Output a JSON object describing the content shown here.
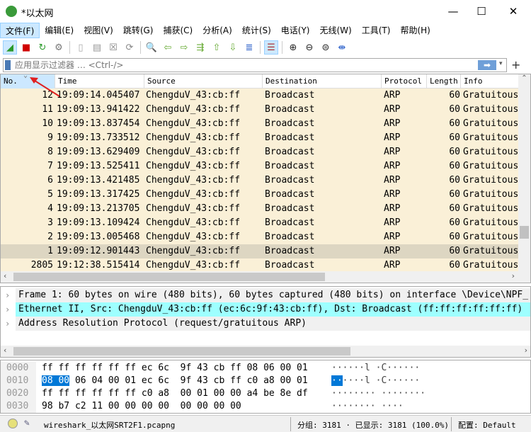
{
  "window": {
    "title": "*以太网",
    "minimize": "—",
    "maximize": "☐",
    "close": "✕"
  },
  "menu": [
    "文件(F)",
    "编辑(E)",
    "视图(V)",
    "跳转(G)",
    "捕获(C)",
    "分析(A)",
    "统计(S)",
    "电话(Y)",
    "无线(W)",
    "工具(T)",
    "帮助(H)"
  ],
  "toolbar": [
    {
      "icon": "shark-fin-start-icon",
      "glyph": "◢",
      "color": "#2a9a2a",
      "on": true
    },
    {
      "icon": "stop-icon",
      "glyph": "■",
      "color": "#d00000"
    },
    {
      "icon": "restart-icon",
      "glyph": "↻",
      "color": "#2a9a2a"
    },
    {
      "icon": "options-gear-icon",
      "glyph": "⚙",
      "color": "#777"
    },
    {
      "sep": true
    },
    {
      "icon": "open-file-icon",
      "glyph": "▯",
      "color": "#aaa"
    },
    {
      "icon": "save-file-icon",
      "glyph": "▤",
      "color": "#999"
    },
    {
      "icon": "close-file-icon",
      "glyph": "☒",
      "color": "#888"
    },
    {
      "icon": "reload-icon",
      "glyph": "⟳",
      "color": "#888"
    },
    {
      "sep": true
    },
    {
      "icon": "find-icon",
      "glyph": "🔍",
      "color": "#333"
    },
    {
      "icon": "back-arrow-icon",
      "glyph": "⇦",
      "color": "#6a3"
    },
    {
      "icon": "forward-arrow-icon",
      "glyph": "⇨",
      "color": "#6a3"
    },
    {
      "icon": "goto-packet-icon",
      "glyph": "⇶",
      "color": "#6a3"
    },
    {
      "icon": "first-packet-icon",
      "glyph": "⇧",
      "color": "#6a3"
    },
    {
      "icon": "last-packet-icon",
      "glyph": "⇩",
      "color": "#6a3"
    },
    {
      "icon": "autoscroll-icon",
      "glyph": "≣",
      "color": "#36c"
    },
    {
      "sep": true
    },
    {
      "icon": "colorize-icon",
      "glyph": "☰",
      "color": "#a33",
      "on": true
    },
    {
      "sep": true
    },
    {
      "icon": "zoom-in-icon",
      "glyph": "⊕",
      "color": "#222"
    },
    {
      "icon": "zoom-out-icon",
      "glyph": "⊖",
      "color": "#222"
    },
    {
      "icon": "zoom-reset-icon",
      "glyph": "⊜",
      "color": "#222"
    },
    {
      "icon": "resize-columns-icon",
      "glyph": "⇼",
      "color": "#36c"
    }
  ],
  "filter": {
    "placeholder": "应用显示过滤器 … <Ctrl-/>",
    "apply": "➡",
    "dropdown": "▾",
    "add": "+"
  },
  "columns": [
    "No.",
    "Time",
    "Source",
    "Destination",
    "Protocol",
    "Length",
    "Info"
  ],
  "sort_indicator": "⌄",
  "packets": [
    [
      "12",
      "19:09:14.045407",
      "ChengduV_43:cb:ff",
      "Broadcast",
      "ARP",
      "60",
      "Gratuitous"
    ],
    [
      "11",
      "19:09:13.941422",
      "ChengduV_43:cb:ff",
      "Broadcast",
      "ARP",
      "60",
      "Gratuitous"
    ],
    [
      "10",
      "19:09:13.837454",
      "ChengduV_43:cb:ff",
      "Broadcast",
      "ARP",
      "60",
      "Gratuitous"
    ],
    [
      "9",
      "19:09:13.733512",
      "ChengduV_43:cb:ff",
      "Broadcast",
      "ARP",
      "60",
      "Gratuitous"
    ],
    [
      "8",
      "19:09:13.629409",
      "ChengduV_43:cb:ff",
      "Broadcast",
      "ARP",
      "60",
      "Gratuitous"
    ],
    [
      "7",
      "19:09:13.525411",
      "ChengduV_43:cb:ff",
      "Broadcast",
      "ARP",
      "60",
      "Gratuitous"
    ],
    [
      "6",
      "19:09:13.421485",
      "ChengduV_43:cb:ff",
      "Broadcast",
      "ARP",
      "60",
      "Gratuitous"
    ],
    [
      "5",
      "19:09:13.317425",
      "ChengduV_43:cb:ff",
      "Broadcast",
      "ARP",
      "60",
      "Gratuitous"
    ],
    [
      "4",
      "19:09:13.213705",
      "ChengduV_43:cb:ff",
      "Broadcast",
      "ARP",
      "60",
      "Gratuitous"
    ],
    [
      "3",
      "19:09:13.109424",
      "ChengduV_43:cb:ff",
      "Broadcast",
      "ARP",
      "60",
      "Gratuitous"
    ],
    [
      "2",
      "19:09:13.005468",
      "ChengduV_43:cb:ff",
      "Broadcast",
      "ARP",
      "60",
      "Gratuitous"
    ],
    [
      "1",
      "19:09:12.901443",
      "ChengduV_43:cb:ff",
      "Broadcast",
      "ARP",
      "60",
      "Gratuitous"
    ],
    [
      "2805",
      "19:12:38.515414",
      "ChengduV_43:cb:ff",
      "Broadcast",
      "ARP",
      "60",
      "Gratuitous"
    ]
  ],
  "selected_packet": "1",
  "colors": {
    "arp_row": "#faf0d7",
    "selected_row": "#ddd6c2",
    "detail_highlight": "#9effff",
    "byte_select": "#0078d7"
  },
  "details": [
    {
      "text": "Frame 1: 60 bytes on wire (480 bits), 60 bytes captured (480 bits) on interface \\Device\\NPF_",
      "highlight": false
    },
    {
      "text": "Ethernet II, Src: ChengduV_43:cb:ff (ec:6c:9f:43:cb:ff), Dst: Broadcast (ff:ff:ff:ff:ff:ff)",
      "highlight": true
    },
    {
      "text": "Address Resolution Protocol (request/gratuitous ARP)",
      "highlight": false
    }
  ],
  "bytes": [
    {
      "offset": "0000",
      "pre": "",
      "sel": "",
      "hex": "ff ff ff ff ff ff ec 6c  9f 43 cb ff 08 06 00 01",
      "asel": "",
      "ascii": "······l ·C······"
    },
    {
      "offset": "0010",
      "pre": "",
      "sel": "08 00",
      "hex": " 06 04 00 01 ec 6c  9f 43 cb ff c0 a8 00 01",
      "asel": "··",
      "ascii": "····l ·C······"
    },
    {
      "offset": "0020",
      "pre": "",
      "sel": "",
      "hex": "ff ff ff ff ff ff c0 a8  00 01 00 00 a4 be 8e df",
      "asel": "",
      "ascii": "········ ········"
    },
    {
      "offset": "0030",
      "pre": "",
      "sel": "",
      "hex": "98 b7 c2 11 00 00 00 00  00 00 00 00",
      "asel": "",
      "ascii": "········ ····"
    }
  ],
  "status": {
    "file": "wireshark_以太网SRT2F1.pcapng",
    "packets": "分组: 3181 · 已显示: 3181 (100.0%)",
    "profile": "配置: Default"
  }
}
